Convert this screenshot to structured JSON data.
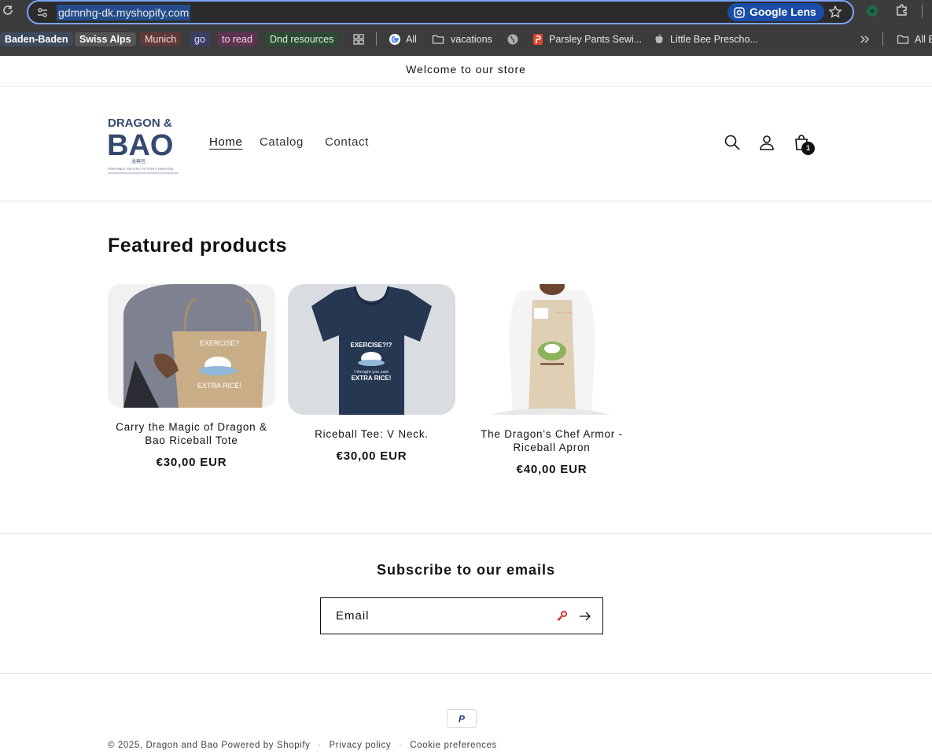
{
  "browser": {
    "url": "gdmnhg-dk.myshopify.com",
    "lens_label": "Google Lens",
    "bookmarks": [
      {
        "label": "Baden-Baden",
        "style": "blue"
      },
      {
        "label": "Swiss Alps",
        "style": "gray"
      },
      {
        "label": "Munich",
        "style": "red"
      },
      {
        "label": "go",
        "style": "indigo"
      },
      {
        "label": "to read",
        "style": "pink"
      },
      {
        "label": "Dnd resources",
        "style": "green"
      },
      {
        "label": "All",
        "icon": "google-icon"
      },
      {
        "label": "vacations",
        "icon": "folder-icon"
      },
      {
        "label": "Parsley Pants Sewi...",
        "icon": "pattern-site-icon"
      },
      {
        "label": "Little Bee Prescho...",
        "icon": "apple-icon"
      },
      {
        "label": "All B",
        "icon": "folder-icon"
      }
    ]
  },
  "store": {
    "announcement": "Welcome to our store",
    "nav": {
      "home": "Home",
      "catalog": "Catalog",
      "contact": "Contact"
    },
    "cart_count": "1",
    "featured_title": "Featured products",
    "products": [
      {
        "title": "Carry the Magic of Dragon & Bao Riceball Tote",
        "price": "€30,00 EUR"
      },
      {
        "title": "Riceball Tee: V Neck.",
        "price": "€30,00 EUR"
      },
      {
        "title": "The Dragon's Chef Armor - Riceball Apron",
        "price": "€40,00 EUR"
      }
    ],
    "subscribe_title": "Subscribe to our emails",
    "email_placeholder": "Email",
    "footer": {
      "copyright": "© 2025, Dragon and Bao",
      "powered": "Powered by Shopify",
      "privacy": "Privacy policy",
      "cookies": "Cookie preferences"
    }
  },
  "logo": {
    "line1": "DRAGON &",
    "line2": "BAO",
    "tagline": "PORTABLE FEASTS. FIT FOR A DRAGON.",
    "chinese": "龙與包"
  },
  "product_art": {
    "tote_line1": "EXERCISE?",
    "tote_line2": "EXTRA RICE!",
    "tee_line1": "EXERCISE?!?",
    "tee_line2": "I thought you said",
    "tee_line3": "EXTRA RICE!"
  },
  "payment": {
    "paypal": "P"
  },
  "colors": {
    "brand_blue": "#34496e",
    "chrome_bg": "#3c3c3c",
    "focus_ring": "#7ba4f4"
  }
}
